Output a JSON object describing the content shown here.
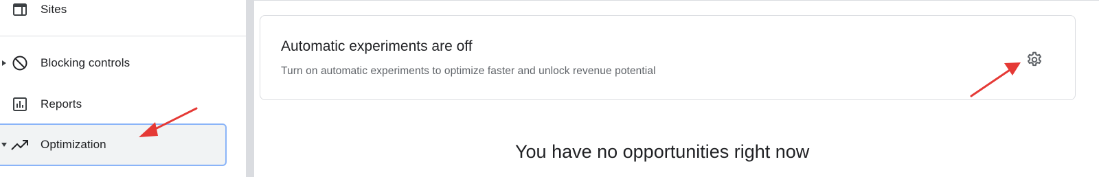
{
  "sidebar": {
    "items": [
      {
        "label": "Sites",
        "icon": "web-layout-icon"
      },
      {
        "label": "Blocking controls",
        "icon": "block-icon"
      },
      {
        "label": "Reports",
        "icon": "bar-chart-icon"
      },
      {
        "label": "Optimization",
        "icon": "trending-up-icon",
        "selected": true
      }
    ]
  },
  "card": {
    "title": "Automatic experiments are off",
    "subtitle": "Turn on automatic experiments to optimize faster and unlock revenue potential",
    "settings_icon": "gear-icon"
  },
  "main": {
    "empty_message": "You have no opportunities right now"
  },
  "colors": {
    "selected_border": "#8ab4f8",
    "selected_bg": "#f1f3f4",
    "annotation_arrow": "#e53935"
  }
}
